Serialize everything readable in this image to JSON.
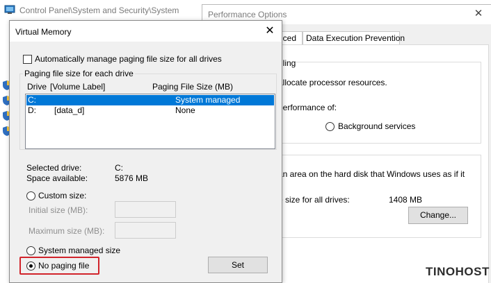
{
  "control_panel": {
    "title": "Control Panel\\System and Security\\System"
  },
  "performance_options": {
    "title": "Performance Options",
    "tabs": [
      "nced",
      "Data Execution Prevention"
    ],
    "scheduling_heading": "uling",
    "scheduling_desc": "allocate processor resources.",
    "performance_of": "performance of:",
    "background_services": "Background services",
    "vm_desc": "an area on the hard disk that Windows uses as if it",
    "total_label": "e size for all drives:",
    "total_value": "1408 MB",
    "change_button": "Change..."
  },
  "virtual_memory": {
    "title": "Virtual Memory",
    "auto_manage": "Automatically manage paging file size for all drives",
    "auto_manage_checked": false,
    "group_label": "Paging file size for each drive",
    "columns": {
      "drive": "Drive",
      "volume_label": "[Volume Label]",
      "paging_size": "Paging File Size (MB)"
    },
    "drives": [
      {
        "drive": "C:",
        "label": "",
        "size": "System managed",
        "selected": true
      },
      {
        "drive": "D:",
        "label": "[data_d]",
        "size": "None",
        "selected": false
      }
    ],
    "selected_drive_label": "Selected drive:",
    "selected_drive_value": "C:",
    "space_available_label": "Space available:",
    "space_available_value": "5876 MB",
    "custom_size": "Custom size:",
    "initial_size": "Initial size (MB):",
    "maximum_size": "Maximum size (MB):",
    "system_managed": "System managed size",
    "no_paging": "No paging file",
    "selected_option": "no_paging",
    "set_button": "Set"
  },
  "watermark": {
    "text": "TINOHOST"
  },
  "colors": {
    "selection": "#0078d7",
    "highlight": "#d1232a"
  }
}
